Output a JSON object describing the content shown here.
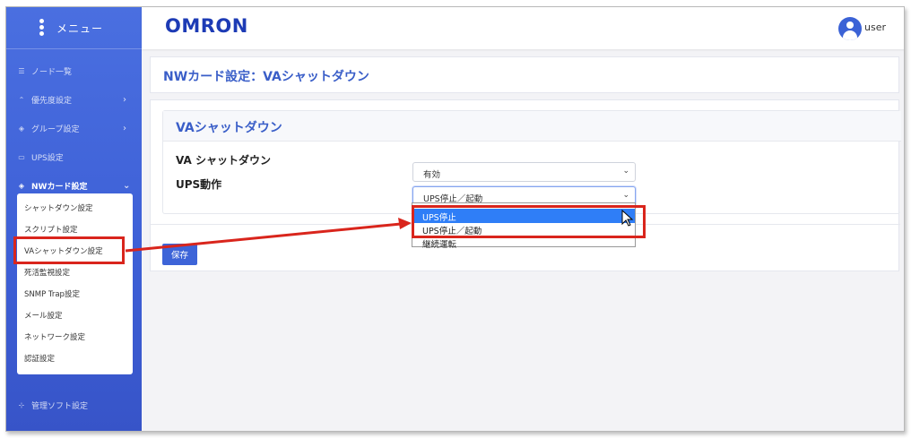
{
  "sidebar": {
    "menu_title": "メニュー",
    "items": [
      {
        "label": "ノード一覧",
        "icon": "list-icon",
        "chevron": ""
      },
      {
        "label": "優先度設定",
        "icon": "priority-icon",
        "chevron": "›"
      },
      {
        "label": "グループ設定",
        "icon": "layers-icon",
        "chevron": "›"
      },
      {
        "label": "UPS設定",
        "icon": "battery-icon",
        "chevron": ""
      },
      {
        "label": "NWカード設定",
        "icon": "layers-icon",
        "chevron": "⌄"
      },
      {
        "label": "管理ソフト設定",
        "icon": "network-icon",
        "chevron": ""
      }
    ],
    "submenu": [
      "シャットダウン設定",
      "スクリプト設定",
      "VAシャットダウン設定",
      "死活監視設定",
      "SNMP Trap設定",
      "メール設定",
      "ネットワーク設定",
      "認証設定"
    ]
  },
  "topbar": {
    "logo": "OMRON",
    "user": "user"
  },
  "page": {
    "title": "NWカード設定：VAシャットダウン"
  },
  "card": {
    "title": "VAシャットダウン",
    "fields": [
      {
        "label": "VA シャットダウン",
        "value": "有効"
      },
      {
        "label": "UPS動作",
        "value": "UPS停止／起動"
      }
    ],
    "save_label": "保存"
  },
  "dropdown": {
    "options": [
      "UPS停止",
      "UPS停止／起動",
      "継続運転"
    ],
    "highlighted": "UPS停止"
  },
  "colors": {
    "sidebar": "#3d5fd6",
    "accent": "#3a5ec8",
    "annotation": "#d9251c",
    "highlight": "#2f7ef7"
  }
}
